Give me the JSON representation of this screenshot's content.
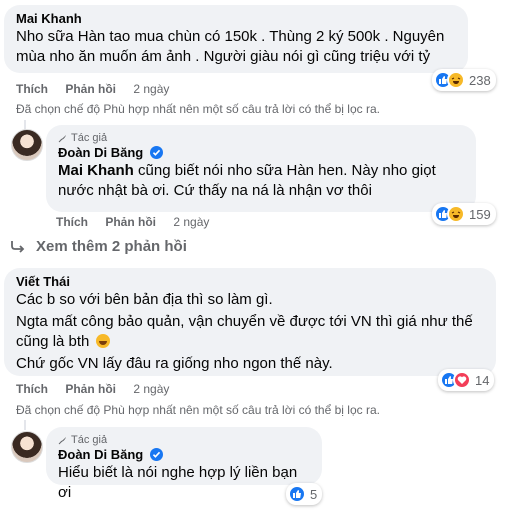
{
  "comment1": {
    "author": "Mai Khanh",
    "text": "Nho sữa Hàn tao mua chùn có 150k . Thùng 2 ký 500k . Nguyên mùa nho ăn muốn ám ảnh . Người giàu nói gì cũng triệu với tỷ",
    "like_label": "Thích",
    "reply_label": "Phản hồi",
    "time": "2 ngày",
    "reaction_count": "238",
    "filter_note": "Đã chọn chế độ Phù hợp nhất nên một số câu trả lời có thể bị lọc ra."
  },
  "reply1": {
    "badge": "Tác giả",
    "author": "Đoàn Di Băng",
    "mention": "Mai Khanh",
    "text": " cũng biết nói nho sữa Hàn hen. Này nho giọt nước nhật bà ơi. Cứ thấy na ná là nhận vơ thôi",
    "like_label": "Thích",
    "reply_label": "Phản hồi",
    "time": "2 ngày",
    "reaction_count": "159"
  },
  "more_replies": "Xem thêm 2 phản hồi",
  "comment2": {
    "author": "Viết Thái",
    "line1": "Các b so với bên bản địa thì so làm gì.",
    "line2": "Ngta mất công bảo quản, vận chuyển về được tới VN thì giá như thế cũng là bth",
    "line3": "Chứ gốc VN lấy đâu ra giống nho ngon thế này.",
    "like_label": "Thích",
    "reply_label": "Phản hồi",
    "time": "2 ngày",
    "reaction_count": "14",
    "filter_note": "Đã chọn chế độ Phù hợp nhất nên một số câu trả lời có thể bị lọc ra."
  },
  "reply2": {
    "badge": "Tác giả",
    "author": "Đoàn Di Băng",
    "text": "Hiểu biết là nói nghe hợp lý liền bạn ơi",
    "reaction_count": "5"
  },
  "colors": {
    "bubble": "#f0f2f5",
    "like": "#1877f2",
    "haha": "#f7b928",
    "love": "#f33e58",
    "meta": "#65676b"
  }
}
